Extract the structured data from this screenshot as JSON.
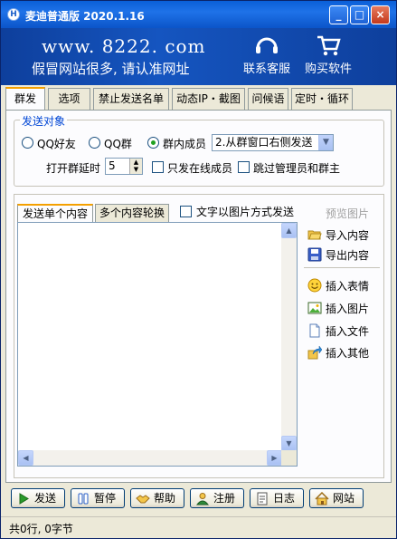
{
  "window": {
    "title": "麦迪普通版 2020.1.16",
    "app_icon_letter": "H",
    "min": "_",
    "max": "□",
    "close": "×"
  },
  "banner": {
    "url": "www. 8222. com",
    "subtitle": "假冒网站很多, 请认准网址",
    "contact_label": "联系客服",
    "buy_label": "购买软件"
  },
  "tabs": [
    {
      "label": "群发"
    },
    {
      "label": "选项"
    },
    {
      "label": "禁止发送名单"
    },
    {
      "label": "动态IP・截图"
    },
    {
      "label": "问候语"
    },
    {
      "label": "定时・循环"
    }
  ],
  "target_group": {
    "title": "发送对象",
    "radio_qq_friend": "QQ好友",
    "radio_qq_group": "QQ群",
    "radio_group_members": "群内成员",
    "member_mode_selected": "2.从群窗口右侧发送",
    "open_delay_label": "打开群延时",
    "open_delay_value": "5",
    "only_online_label": "只发在线成员",
    "skip_admin_label": "跳过管理员和群主"
  },
  "content": {
    "tab_single": "发送单个内容",
    "tab_multiple": "多个内容轮换",
    "image_mode_label": "文字以图片方式发送",
    "preview_label": "预览图片",
    "import_label": "导入内容",
    "export_label": "导出内容",
    "insert_emoji_label": "插入表情",
    "insert_image_label": "插入图片",
    "insert_file_label": "插入文件",
    "insert_other_label": "插入其他"
  },
  "buttons": {
    "send": "发送",
    "pause": "暂停",
    "help": "帮助",
    "register": "注册",
    "log": "日志",
    "website": "网站"
  },
  "status": {
    "text": "共0行, 0字节"
  },
  "colors": {
    "title_bar": "#0a5fd8",
    "banner": "#1555c0",
    "group_title": "#0046d5",
    "tab_highlight": "#f4a000"
  }
}
